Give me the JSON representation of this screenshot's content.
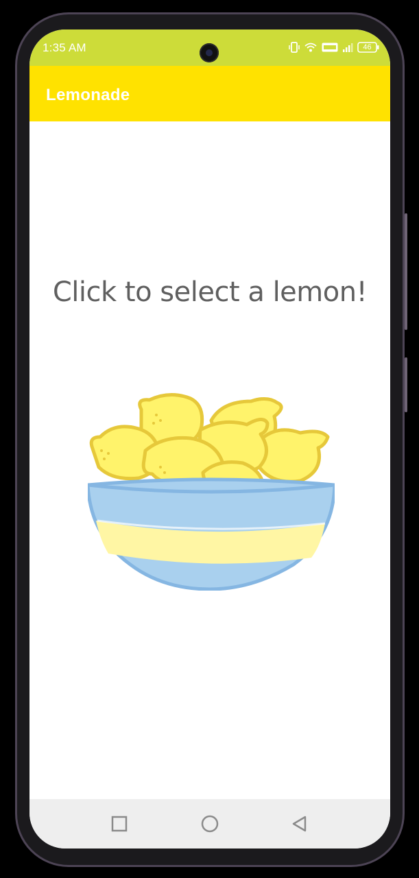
{
  "status_bar": {
    "time": "1:35 AM",
    "battery": "46",
    "icons": [
      "vibrate-icon",
      "wifi-icon",
      "volte-icon",
      "signal-icon",
      "battery-icon"
    ]
  },
  "app_bar": {
    "title": "Lemonade",
    "color": "#FFE200"
  },
  "main": {
    "instruction": "Click to select a lemon!",
    "image": "lemon-tree-bowl-icon"
  },
  "nav_bar": {
    "buttons": [
      "recent-apps-icon",
      "home-icon",
      "back-icon"
    ]
  },
  "colors": {
    "status_bar": "#CDDC39",
    "app_bar": "#FFE200",
    "lemon": "#FFF36B",
    "bowl": "#A9D0EE"
  }
}
